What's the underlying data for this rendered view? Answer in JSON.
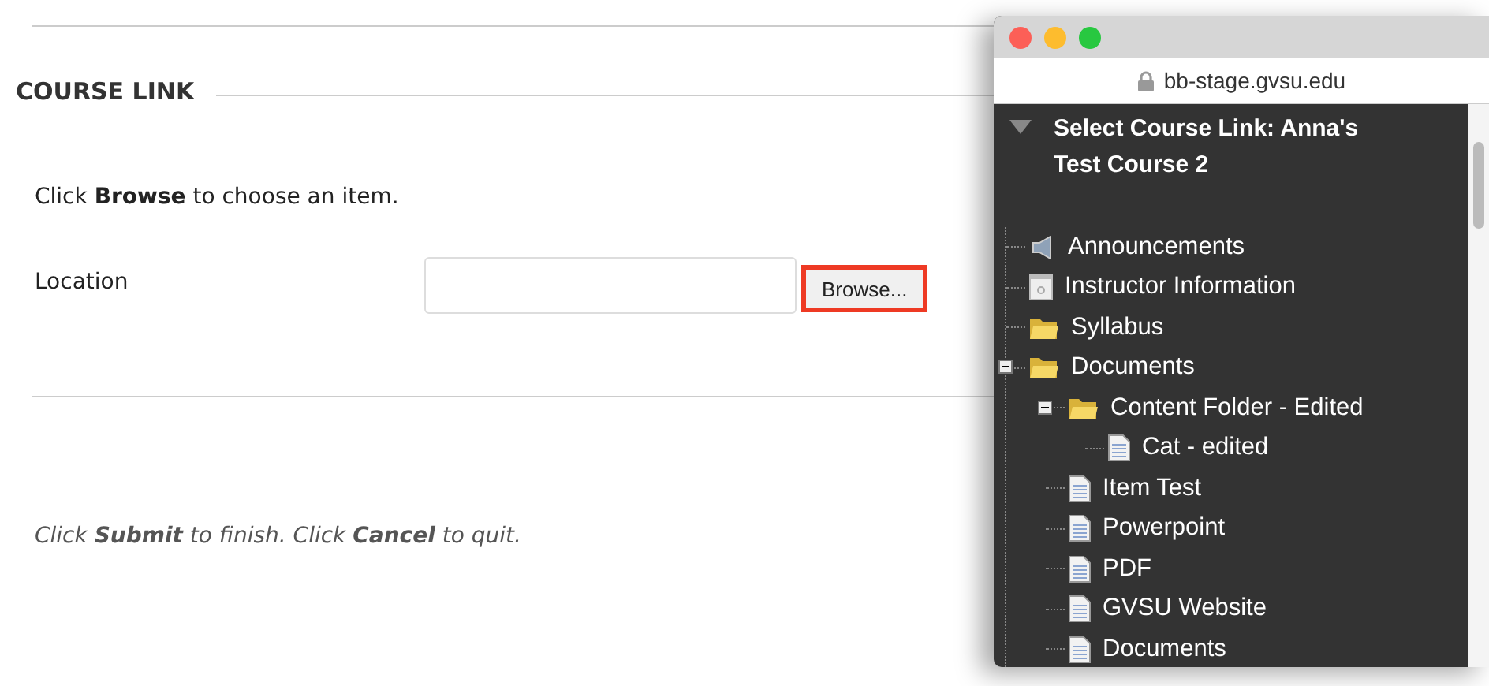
{
  "page": {
    "section_title": "COURSE LINK",
    "instruction": "Click **Browse** to choose an item.",
    "location_label": "Location",
    "browse_button": "Browse...",
    "footer": "Click **Submit** to finish. Click **Cancel** to quit."
  },
  "popup": {
    "url": "bb-stage.gvsu.edu",
    "header": "Select Course Link: Anna's Test Course 2",
    "tree": [
      {
        "label": "Announcements",
        "kind": "announcement"
      },
      {
        "label": "Instructor Information",
        "kind": "info"
      },
      {
        "label": "Syllabus",
        "kind": "folder"
      },
      {
        "label": "Documents",
        "kind": "folder",
        "expanded": true,
        "children": [
          {
            "label": "Content Folder - Edited",
            "kind": "folder",
            "expanded": true,
            "children": [
              {
                "label": "Cat - edited",
                "kind": "document"
              }
            ]
          },
          {
            "label": "Item Test",
            "kind": "document"
          },
          {
            "label": "Powerpoint",
            "kind": "document"
          },
          {
            "label": "PDF",
            "kind": "document"
          },
          {
            "label": "GVSU Website",
            "kind": "document"
          },
          {
            "label": "Documents",
            "kind": "document"
          }
        ]
      }
    ]
  }
}
